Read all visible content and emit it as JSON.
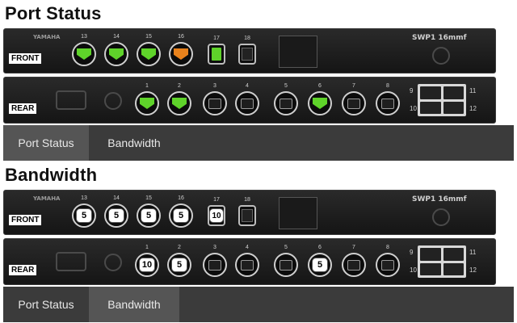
{
  "sections": [
    {
      "title": "Port Status",
      "mode": "status",
      "front_label": "FRONT",
      "rear_label": "REAR",
      "front_ports": [
        {
          "num": "13",
          "state": "green"
        },
        {
          "num": "14",
          "state": "green"
        },
        {
          "num": "15",
          "state": "green"
        },
        {
          "num": "16",
          "state": "orange"
        }
      ],
      "sfp_ports": [
        {
          "num": "17",
          "state": "green"
        },
        {
          "num": "18",
          "state": "off"
        }
      ],
      "rear_ports": [
        {
          "num": "1",
          "state": "green"
        },
        {
          "num": "2",
          "state": "green"
        },
        {
          "num": "3",
          "state": "off"
        },
        {
          "num": "4",
          "state": "off"
        },
        {
          "num": "5",
          "state": "off"
        },
        {
          "num": "6",
          "state": "green"
        },
        {
          "num": "7",
          "state": "off"
        },
        {
          "num": "8",
          "state": "off"
        }
      ],
      "rear_side_nums": [
        "9",
        "10",
        "11",
        "12"
      ],
      "tabs": [
        {
          "label": "Port Status",
          "active": true
        },
        {
          "label": "Bandwidth",
          "active": false
        }
      ]
    },
    {
      "title": "Bandwidth",
      "mode": "bandwidth",
      "front_label": "FRONT",
      "rear_label": "REAR",
      "front_ports": [
        {
          "num": "13",
          "state": "5"
        },
        {
          "num": "14",
          "state": "5"
        },
        {
          "num": "15",
          "state": "5"
        },
        {
          "num": "16",
          "state": "5"
        }
      ],
      "sfp_ports": [
        {
          "num": "17",
          "state": "10"
        },
        {
          "num": "18",
          "state": "off"
        }
      ],
      "rear_ports": [
        {
          "num": "1",
          "state": "10"
        },
        {
          "num": "2",
          "state": "5"
        },
        {
          "num": "3",
          "state": "off"
        },
        {
          "num": "4",
          "state": "off"
        },
        {
          "num": "5",
          "state": "off"
        },
        {
          "num": "6",
          "state": "5"
        },
        {
          "num": "7",
          "state": "off"
        },
        {
          "num": "8",
          "state": "off"
        }
      ],
      "rear_side_nums": [
        "9",
        "10",
        "11",
        "12"
      ],
      "tabs": [
        {
          "label": "Port Status",
          "active": false
        },
        {
          "label": "Bandwidth",
          "active": true
        }
      ]
    }
  ],
  "brand_left": "YAMAHA",
  "model": "SWP1 16mmf",
  "colors": {
    "green": "#5fd32a",
    "orange": "#e8821c",
    "tab_bg": "#3b3b3b",
    "tab_active": "#555555"
  },
  "icons": {
    "front_port": "ethercon-jack-icon",
    "sfp_port": "sfp-port-icon",
    "rear_rj_block": "rj45-quad-icon"
  }
}
